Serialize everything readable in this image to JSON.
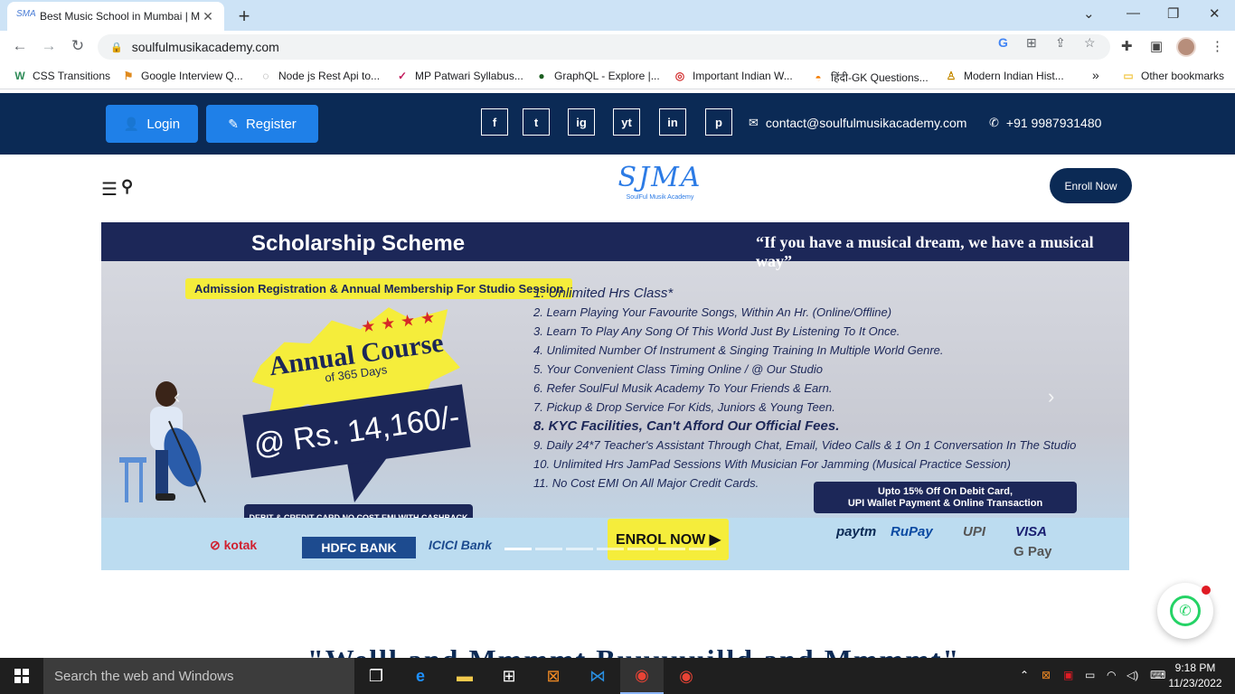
{
  "browser": {
    "tab_title": "Best Music School in Mumbai | M",
    "url": "soulfulmusikacademy.com",
    "bookmarks": [
      {
        "label": "CSS Transitions",
        "icon": "w-icon"
      },
      {
        "label": "Google Interview Q...",
        "icon": "flag-icon"
      },
      {
        "label": "Node js Rest Api to...",
        "icon": "doc-icon"
      },
      {
        "label": "MP Patwari Syllabus...",
        "icon": "check-icon"
      },
      {
        "label": "GraphQL - Explore |...",
        "icon": "leaf-icon"
      },
      {
        "label": "Important Indian W...",
        "icon": "target-icon"
      },
      {
        "label": "हिंदी-GK Questions...",
        "icon": "sun-icon"
      },
      {
        "label": "Modern Indian Hist...",
        "icon": "person-icon"
      }
    ],
    "overflow_label": "»",
    "other_bookmarks": "Other bookmarks"
  },
  "site": {
    "login_label": "Login",
    "register_label": "Register",
    "social": [
      "f",
      "t",
      "ig",
      "yt",
      "in",
      "p"
    ],
    "email": "contact@soulfulmusikacademy.com",
    "phone": "+91 9987931480",
    "logo_mark": "SJMA",
    "logo_text": "SoulFul Musik Academy",
    "enroll_label": "Enroll Now"
  },
  "banner": {
    "title": "Scholarship Scheme",
    "quote": "“If you have a musical dream, we have a musical way”",
    "admission": "Admission Registration & Annual Membership For Studio Session",
    "course_title": "Annual Course",
    "course_days": "of 365 Days",
    "price": "@ Rs. 14,160/-",
    "cashback": "DEBIT & CREDIT CARD NO COST EMI WITH CASHBACK",
    "features": [
      "1. Unlimited Hrs Class*",
      "2. Learn Playing Your Favourite Songs, Within An Hr. (Online/Offline)",
      "3. Learn To Play Any Song Of This World Just By Listening To It Once.",
      "4. Unlimited Number Of Instrument & Singing Training In Multiple World Genre.",
      "5. Your Convenient Class Timing Online / @ Our Studio",
      "6. Refer SoulFul Musik Academy To Your Friends & Earn.",
      "7. Pickup & Drop Service For Kids, Juniors & Young Teen.",
      "8. KYC Facilities, Can't Afford Our Official Fees.",
      "9. Daily 24*7 Teacher's Assistant Through Chat, Email, Video Calls & 1 On 1 Conversation In The Studio",
      "10. Unlimited Hrs JamPad Sessions With Musician For Jamming (Musical Practice Session)",
      "11. No Cost EMI On All Major Credit Cards."
    ],
    "offer_line1": "Upto 15% Off On Debit Card,",
    "offer_line2": "UPI Wallet Payment & Online Transaction",
    "bank_kotak": "kotak",
    "bank_hdfc": "HDFC BANK",
    "bank_icici": "ICICI Bank",
    "enrol_cta": "ENROL NOW ▶",
    "pay_paytm": "paytm",
    "pay_rupay": "RuPay",
    "pay_upi": "UPI",
    "pay_visa": "VISA",
    "pay_gpay": "G Pay",
    "slide_count": 7,
    "active_slide": 1
  },
  "page": {
    "heading_peek": "\"Welll and Mmmmt Buuuuuilld and Mmmmt\""
  },
  "taskbar": {
    "search_placeholder": "Search the web and Windows",
    "time": "9:18 PM",
    "date": "11/23/2022"
  },
  "colors": {
    "navy": "#0b2a55",
    "blue_button": "#1f80e8",
    "banner_dark": "#1c2758",
    "yellow": "#f5ed3b"
  }
}
